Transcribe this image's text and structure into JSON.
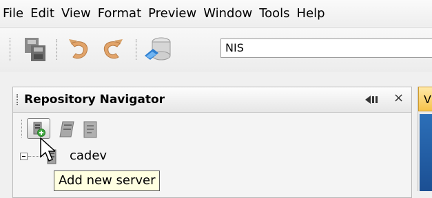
{
  "menu": [
    "File",
    "Edit",
    "View",
    "Format",
    "Preview",
    "Window",
    "Tools",
    "Help"
  ],
  "toolbar": {
    "combo_value": "NIS",
    "icons": [
      "save-all-icon",
      "undo-icon",
      "redo-icon",
      "connect-icon"
    ]
  },
  "navigator": {
    "title": "Repository Navigator",
    "close_glyph": "×",
    "toolbar_icons": [
      "add-server-icon",
      "remove-server-icon",
      "properties-icon"
    ],
    "tree": [
      {
        "label": "cadev",
        "expanded": true
      }
    ]
  },
  "tooltip": "Add new server",
  "right_tab_label": "V",
  "colors": {
    "tooltip_bg": "#ffffe1",
    "accent_blue": "#1b4f93"
  }
}
